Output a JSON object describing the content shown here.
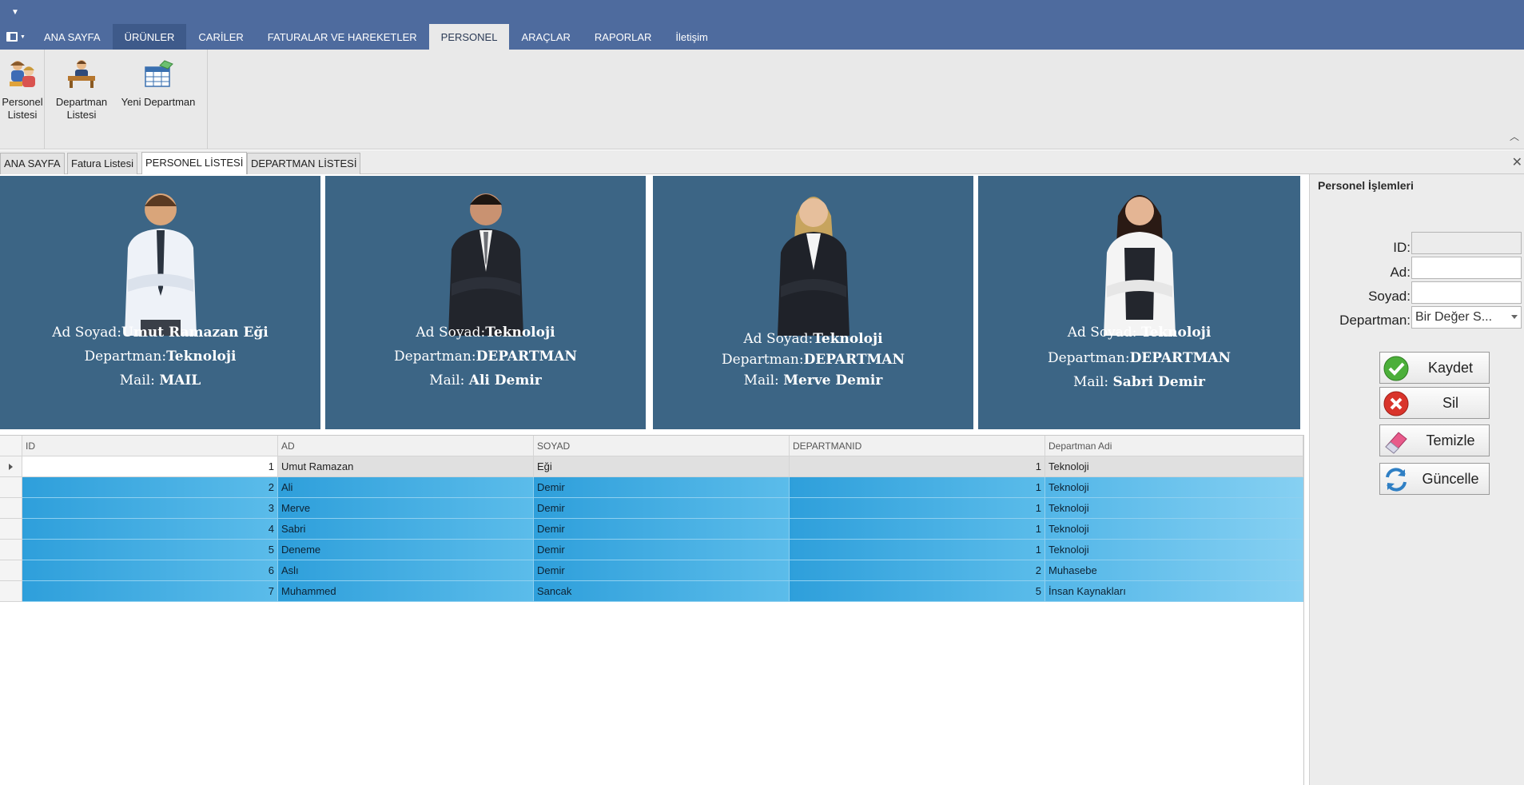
{
  "ribbon": {
    "tabs": [
      "ANA SAYFA",
      "ÜRÜNLER",
      "CARİLER",
      "FATURALAR VE HAREKETLER",
      "PERSONEL",
      "ARAÇLAR",
      "RAPORLAR",
      "İletişim"
    ],
    "active_tab": "PERSONEL",
    "buttons": {
      "personel_listesi": "Personel Listesi",
      "departman_listesi": "Departman Listesi",
      "yeni_departman": "Yeni Departman"
    }
  },
  "doc_tabs": [
    "ANA SAYFA",
    "Fatura Listesi",
    "PERSONEL LİSTESİ",
    "DEPARTMAN LİSTESİ"
  ],
  "active_doc_tab": "PERSONEL LİSTESİ",
  "cards": [
    {
      "ad_soyad_label": "Ad Soyad:",
      "ad_soyad": "Umut Ramazan Eği",
      "departman_label": "Departman:",
      "departman": "Teknoloji",
      "mail_label": "Mail:",
      "mail": "MAIL"
    },
    {
      "ad_soyad_label": "Ad Soyad:",
      "ad_soyad": "Teknoloji",
      "departman_label": "Departman:",
      "departman": "DEPARTMAN",
      "mail_label": "Mail:",
      "mail": "Ali Demir"
    },
    {
      "ad_soyad_label": "Ad Soyad:",
      "ad_soyad": "Teknoloji",
      "departman_label": "Departman:",
      "departman": "DEPARTMAN",
      "mail_label": "Mail:",
      "mail": "Merve Demir"
    },
    {
      "ad_soyad_label": "Ad Soyad:",
      "ad_soyad": "Teknoloji",
      "departman_label": "Departman:",
      "departman": "DEPARTMAN",
      "mail_label": "Mail:",
      "mail": "Sabri Demir"
    }
  ],
  "grid": {
    "columns": [
      "ID",
      "AD",
      "SOYAD",
      "DEPARTMANID",
      "Departman Adi"
    ],
    "rows": [
      [
        "1",
        "Umut Ramazan",
        "Eği",
        "1",
        "Teknoloji"
      ],
      [
        "2",
        "Ali",
        "Demir",
        "1",
        "Teknoloji"
      ],
      [
        "3",
        "Merve",
        "Demir",
        "1",
        "Teknoloji"
      ],
      [
        "4",
        "Sabri",
        "Demir",
        "1",
        "Teknoloji"
      ],
      [
        "5",
        "Deneme",
        "Demir",
        "1",
        "Teknoloji"
      ],
      [
        "6",
        "Aslı",
        "Demir",
        "2",
        "Muhasebe"
      ],
      [
        "7",
        "Muhammed",
        "Sancak",
        "5",
        "İnsan Kaynakları"
      ]
    ]
  },
  "side_panel": {
    "title": "Personel İşlemleri",
    "labels": {
      "id": "ID:",
      "ad": "Ad:",
      "soyad": "Soyad:",
      "departman": "Departman:"
    },
    "values": {
      "id": "",
      "ad": "",
      "soyad": ""
    },
    "departman_select": "Bir Değer S...",
    "buttons": {
      "kaydet": "Kaydet",
      "sil": "Sil",
      "temizle": "Temizle",
      "guncelle": "Güncelle"
    }
  },
  "colors": {
    "ribbon": "#4e6b9e",
    "card_bg": "#3c6585",
    "selection": "#2e9fdb"
  }
}
